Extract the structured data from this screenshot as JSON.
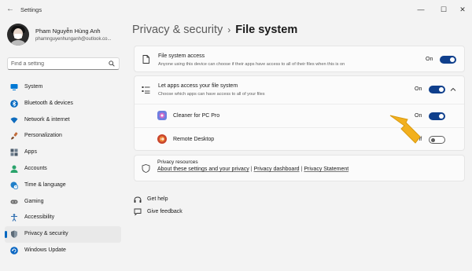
{
  "window": {
    "title": "Settings",
    "back_glyph": "←",
    "controls": {
      "minimize": "—",
      "maximize": "☐",
      "close": "✕"
    }
  },
  "profile": {
    "name": "Pham Nguyễn Hùng Anh",
    "email": "phamnguyenhunganh@outlook.co..."
  },
  "search": {
    "placeholder": "Find a setting",
    "value": ""
  },
  "sidebar": {
    "items": [
      {
        "label": "System",
        "icon": "monitor-icon",
        "color": "#0078d4"
      },
      {
        "label": "Bluetooth & devices",
        "icon": "bluetooth-icon",
        "color": "#0067c0"
      },
      {
        "label": "Network & internet",
        "icon": "wifi-icon",
        "color": "#0f6cbd"
      },
      {
        "label": "Personalization",
        "icon": "paintbrush-icon",
        "color": "#c36d3c"
      },
      {
        "label": "Apps",
        "icon": "apps-icon",
        "color": "#4a5a6a"
      },
      {
        "label": "Accounts",
        "icon": "person-icon",
        "color": "#2aa36b"
      },
      {
        "label": "Time & language",
        "icon": "globe-clock-icon",
        "color": "#1f7fc9"
      },
      {
        "label": "Gaming",
        "icon": "gamepad-icon",
        "color": "#6b6b6b"
      },
      {
        "label": "Accessibility",
        "icon": "accessibility-icon",
        "color": "#2b6cb0"
      },
      {
        "label": "Privacy & security",
        "icon": "shield-icon",
        "color": "#5d6b78",
        "active": true
      },
      {
        "label": "Windows Update",
        "icon": "update-icon",
        "color": "#0a66c2"
      }
    ]
  },
  "breadcrumb": {
    "parent": "Privacy & security",
    "separator": "›",
    "current": "File system"
  },
  "file_system_access": {
    "title": "File system access",
    "subtitle": "Anyone using this device can choose if their apps have access to all of their files when this is on",
    "state": "On",
    "on": true
  },
  "let_apps": {
    "title": "Let apps access your file system",
    "subtitle": "Choose which apps can have access to all of your files",
    "state": "On",
    "on": true,
    "expand_glyph": "^"
  },
  "apps": [
    {
      "name": "Cleaner for PC Pro",
      "state": "On",
      "on": true,
      "icon": "cleaner-app-icon"
    },
    {
      "name": "Remote Desktop",
      "state": "Off",
      "on": false,
      "icon": "remote-desktop-icon"
    }
  ],
  "privacy_resources": {
    "title": "Privacy resources",
    "links": [
      "About these settings and your privacy",
      "Privacy dashboard",
      "Privacy Statement"
    ],
    "separator": "|"
  },
  "help": {
    "get_help": "Get help",
    "give_feedback": "Give feedback"
  },
  "colors": {
    "accent": "#0f3f8c",
    "pointer_arrow": "#f2b01e"
  }
}
